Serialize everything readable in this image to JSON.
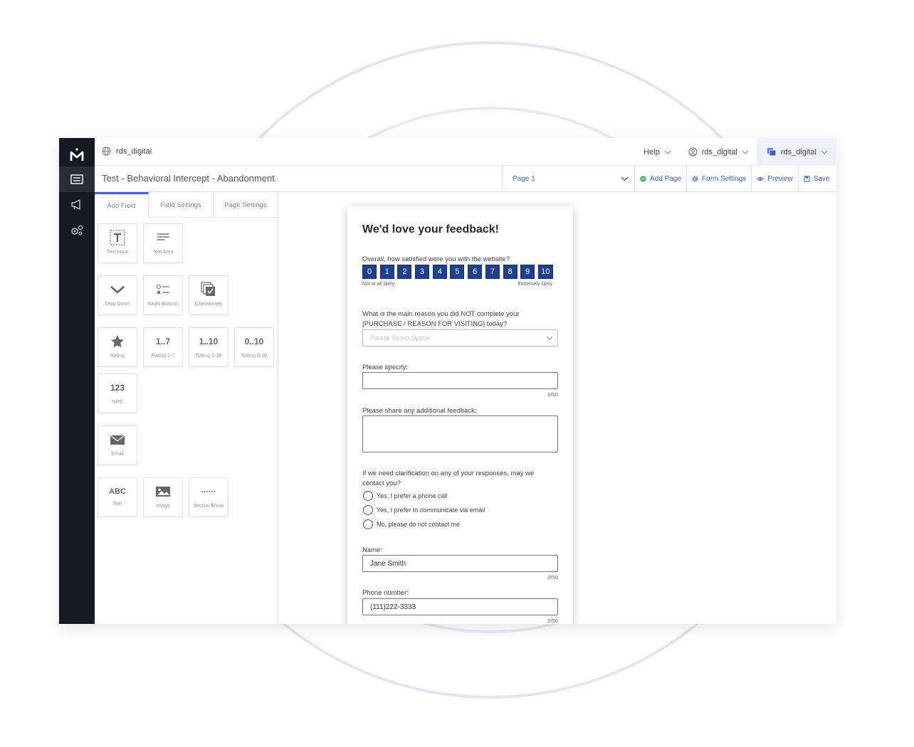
{
  "org": {
    "name": "rds_digital"
  },
  "topbar": {
    "help": "Help",
    "user": "rds_digital",
    "account": "rds_digital"
  },
  "form_title": "Test - Behavioral Intercept - Abandonment",
  "page_select": "Page 1",
  "actions": {
    "add_page": "Add Page",
    "form_settings": "Form Settings",
    "preview": "Preview",
    "save": "Save"
  },
  "tabs": [
    "Add Field",
    "Field Settings",
    "Page Settings"
  ],
  "tiles": {
    "text_input": "Text Input",
    "text_area": "Text Area",
    "drop_down": "Drop Down",
    "radio_buttons": "Radio Buttons",
    "checkboxes": "Checkboxes",
    "rating": "Rating",
    "rating17_icon": "1..7",
    "rating17": "Rating 1-7",
    "rating110_icon": "1..10",
    "rating110": "Rating 1-10",
    "rating010_icon": "0..10",
    "rating010": "Rating 0-10",
    "nps_icon": "123",
    "nps": "NPS",
    "email": "Email",
    "text_icon": "ABC",
    "text": "Text",
    "image": "Image",
    "section_break": "Section Break"
  },
  "form": {
    "title": "We'd love your feedback!",
    "q1": "Overall, how satisfied were you with the website?",
    "scale": [
      "0",
      "1",
      "2",
      "3",
      "4",
      "5",
      "6",
      "7",
      "8",
      "9",
      "10"
    ],
    "scale_low": "Not at all likely",
    "scale_high": "Extremely likely",
    "q2_line1": "What is the main reason you did NOT complete your",
    "q2_line2": "[PURCHASE / REASON FOR VISITING] today?",
    "q2_placeholder": "Please Select Option",
    "q3": "Please specify:",
    "q3_counter": "0/50",
    "q4": "Please share any additional feedback:",
    "q5_line1": "If we need clarification on any of your responses, may we",
    "q5_line2": "contact you?",
    "q5_options": [
      "Yes, I prefer a phone call",
      "Yes, I prefer to communicate via email",
      "No, please do not contact me"
    ],
    "name_label": "Name:",
    "name_value": "Jane Smith",
    "name_counter": "0/50",
    "phone_label": "Phone number:",
    "phone_value": "(111)222-3333",
    "phone_counter": "0/50"
  },
  "colors": {
    "rail": "#16191f",
    "accent": "#3b63d1",
    "scale_box": "#1f3f8f",
    "add_page_green": "#2fa34a"
  },
  "icons": [
    "logo-icon",
    "forms-icon",
    "megaphone-icon",
    "gears-icon",
    "globe-icon",
    "chevron-down-icon",
    "user-circle-icon",
    "pages-icon",
    "plus-circle-icon",
    "gear-icon",
    "eye-icon",
    "save-icon",
    "star-icon",
    "envelope-icon",
    "image-icon"
  ]
}
